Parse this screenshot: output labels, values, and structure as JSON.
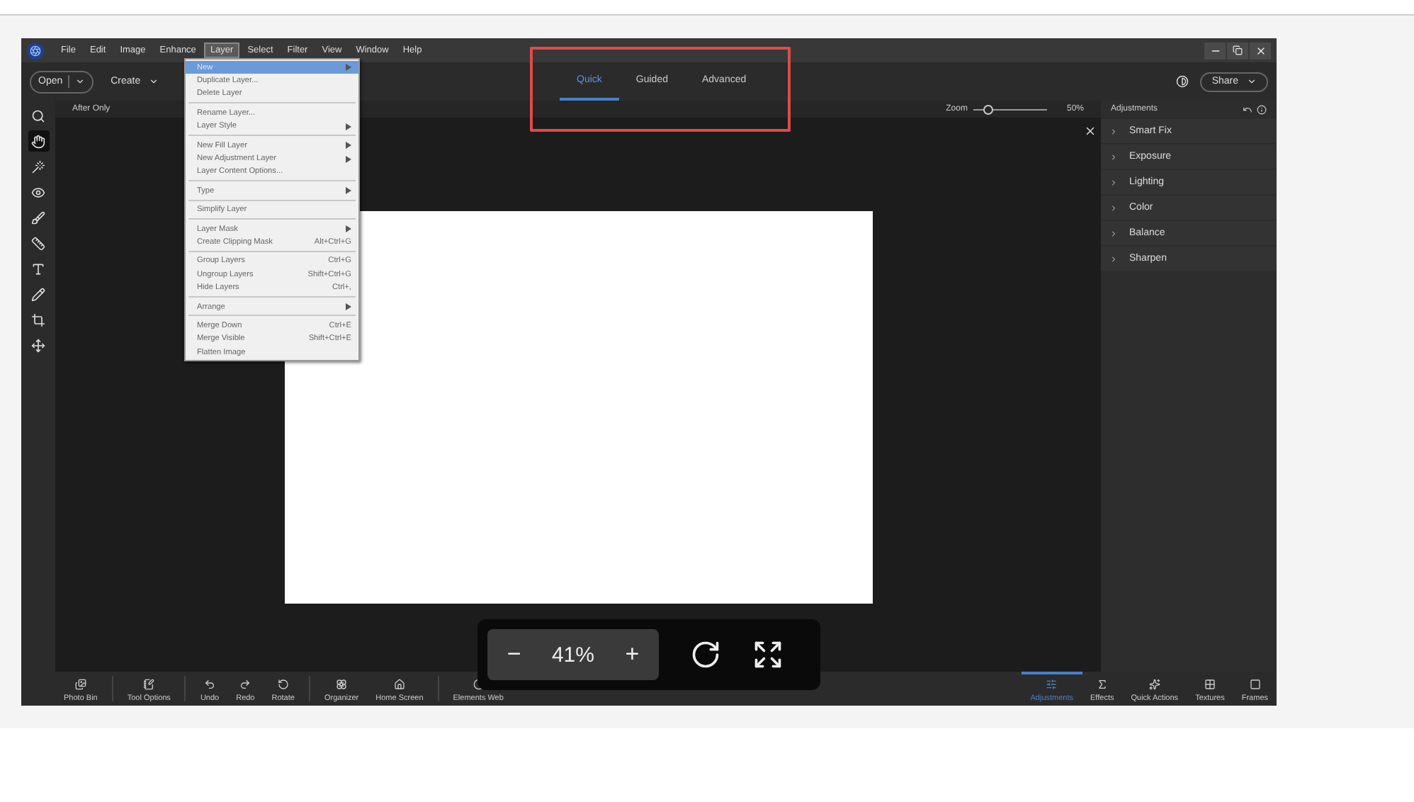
{
  "menu_bar": [
    {
      "label": "File",
      "selected": false
    },
    {
      "label": "Edit",
      "selected": false
    },
    {
      "label": "Image",
      "selected": false
    },
    {
      "label": "Enhance",
      "selected": false
    },
    {
      "label": "Layer",
      "selected": true
    },
    {
      "label": "Select",
      "selected": false
    },
    {
      "label": "Filter",
      "selected": false
    },
    {
      "label": "View",
      "selected": false
    },
    {
      "label": "Window",
      "selected": false
    },
    {
      "label": "Help",
      "selected": false
    }
  ],
  "layer_menu": [
    [
      {
        "label": "New",
        "submenu": true,
        "selected": true
      },
      {
        "label": "Duplicate Layer...",
        "submenu": false,
        "selected": false
      },
      {
        "label": "Delete Layer",
        "submenu": false,
        "selected": false
      }
    ],
    [
      {
        "label": "Rename Layer...",
        "submenu": false,
        "selected": false
      },
      {
        "label": "Layer Style",
        "submenu": true,
        "selected": false
      }
    ],
    [
      {
        "label": "New Fill Layer",
        "submenu": true,
        "selected": false
      },
      {
        "label": "New Adjustment Layer",
        "submenu": true,
        "selected": false
      },
      {
        "label": "Layer Content Options...",
        "submenu": false,
        "selected": false
      }
    ],
    [
      {
        "label": "Type",
        "submenu": true,
        "selected": false
      }
    ],
    [
      {
        "label": "Simplify Layer",
        "submenu": false,
        "selected": false
      }
    ],
    [
      {
        "label": "Layer Mask",
        "submenu": true,
        "selected": false
      },
      {
        "label": "Create Clipping Mask",
        "shortcut": "Alt+Ctrl+G",
        "submenu": false,
        "selected": false
      }
    ],
    [
      {
        "label": "Group Layers",
        "shortcut": "Ctrl+G",
        "submenu": false,
        "selected": false
      },
      {
        "label": "Ungroup Layers",
        "shortcut": "Shift+Ctrl+G",
        "submenu": false,
        "selected": false
      },
      {
        "label": "Hide Layers",
        "shortcut": "Ctrl+,",
        "submenu": false,
        "selected": false
      }
    ],
    [
      {
        "label": "Arrange",
        "submenu": true,
        "selected": false
      }
    ],
    [
      {
        "label": "Merge Down",
        "shortcut": "Ctrl+E",
        "submenu": false,
        "selected": false
      },
      {
        "label": "Merge Visible",
        "shortcut": "Shift+Ctrl+E",
        "submenu": false,
        "selected": false
      },
      {
        "label": "Flatten Image",
        "submenu": false,
        "selected": false
      }
    ]
  ],
  "toolbar": {
    "open": "Open",
    "create": "Create",
    "modes": [
      {
        "label": "Quick",
        "selected": true
      },
      {
        "label": "Guided",
        "selected": false
      },
      {
        "label": "Advanced",
        "selected": false
      }
    ],
    "share": "Share"
  },
  "tools": [
    {
      "selected": false
    },
    {
      "selected": true
    },
    {
      "selected": false
    },
    {
      "selected": false
    },
    {
      "selected": false
    },
    {
      "selected": false
    },
    {
      "selected": false
    },
    {
      "selected": false
    },
    {
      "selected": false
    },
    {
      "selected": false
    }
  ],
  "canvas_header": {
    "view": "After Only",
    "zoom_label": "Zoom",
    "zoom": {
      "level": 0.2
    },
    "zoom_reading": "50%"
  },
  "adjustments": {
    "title": "Adjustments",
    "items": [
      {
        "label": "Smart Fix"
      },
      {
        "label": "Exposure"
      },
      {
        "label": "Lighting"
      },
      {
        "label": "Color"
      },
      {
        "label": "Balance"
      },
      {
        "label": "Sharpen"
      }
    ]
  },
  "zoom_overlay": {
    "minus": "−",
    "reading": "41%",
    "plus": "+"
  },
  "bottom_left": [
    {
      "label": "Photo Bin"
    },
    {
      "label": "Tool Options"
    },
    {
      "label": "Undo"
    },
    {
      "label": "Redo"
    },
    {
      "label": "Rotate"
    },
    {
      "label": "Organizer"
    },
    {
      "label": "Home Screen"
    },
    {
      "label": "Elements Web"
    }
  ],
  "bottom_right": [
    {
      "label": "Adjustments",
      "selected": true
    },
    {
      "label": "Effects",
      "selected": false
    },
    {
      "label": "Quick Actions",
      "selected": false
    },
    {
      "label": "Textures",
      "selected": false
    },
    {
      "label": "Frames",
      "selected": false
    }
  ]
}
